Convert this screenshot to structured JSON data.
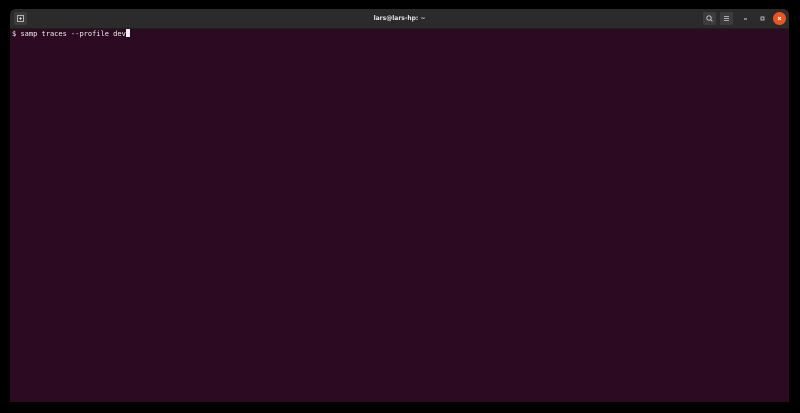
{
  "window": {
    "title": "lars@lars-hp: ~"
  },
  "titlebar": {
    "new_tab_icon": "new-tab-icon",
    "search_icon": "search-icon",
    "menu_icon": "hamburger-menu-icon",
    "minimize_icon": "minimize-icon",
    "maximize_icon": "maximize-icon",
    "close_icon": "close-icon"
  },
  "terminal": {
    "prompt": "$",
    "command": "samp traces --profile dev"
  },
  "colors": {
    "terminal_background": "#2c0b22",
    "titlebar_background": "#2b2b2b",
    "close_button": "#e95420",
    "text": "#eeeeec"
  }
}
